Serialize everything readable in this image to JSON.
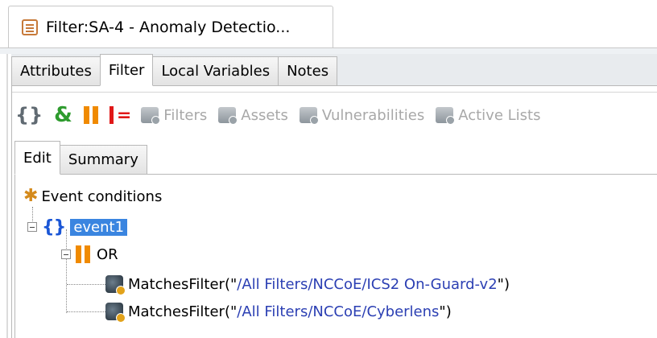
{
  "window_tab": {
    "title": "Filter:SA-4 - Anomaly Detectio..."
  },
  "main_tabs": [
    "Attributes",
    "Filter",
    "Local Variables",
    "Notes"
  ],
  "toolbar": {
    "and_symbol": "&",
    "items": [
      "Filters",
      "Assets",
      "Vulnerabilities",
      "Active Lists"
    ]
  },
  "sub_tabs": [
    "Edit",
    "Summary"
  ],
  "tree": {
    "root_label": "Event conditions",
    "event_label": "event1",
    "or_label": "OR",
    "filters": [
      {
        "func": "MatchesFilter(\"",
        "path": "/All Filters/NCCoE/ICS2 On-Guard-v2",
        "close": "\")"
      },
      {
        "func": "MatchesFilter(\"",
        "path": "/All Filters/NCCoE/Cyberlens",
        "close": "\")"
      }
    ]
  },
  "colors": {
    "selection": "#3a85e0",
    "braces": "#1a56d6",
    "or_bars": "#f08a00",
    "not_equal": "#e01818",
    "and_symbol": "#2e9b2e",
    "path_text": "#2b3fb3"
  }
}
